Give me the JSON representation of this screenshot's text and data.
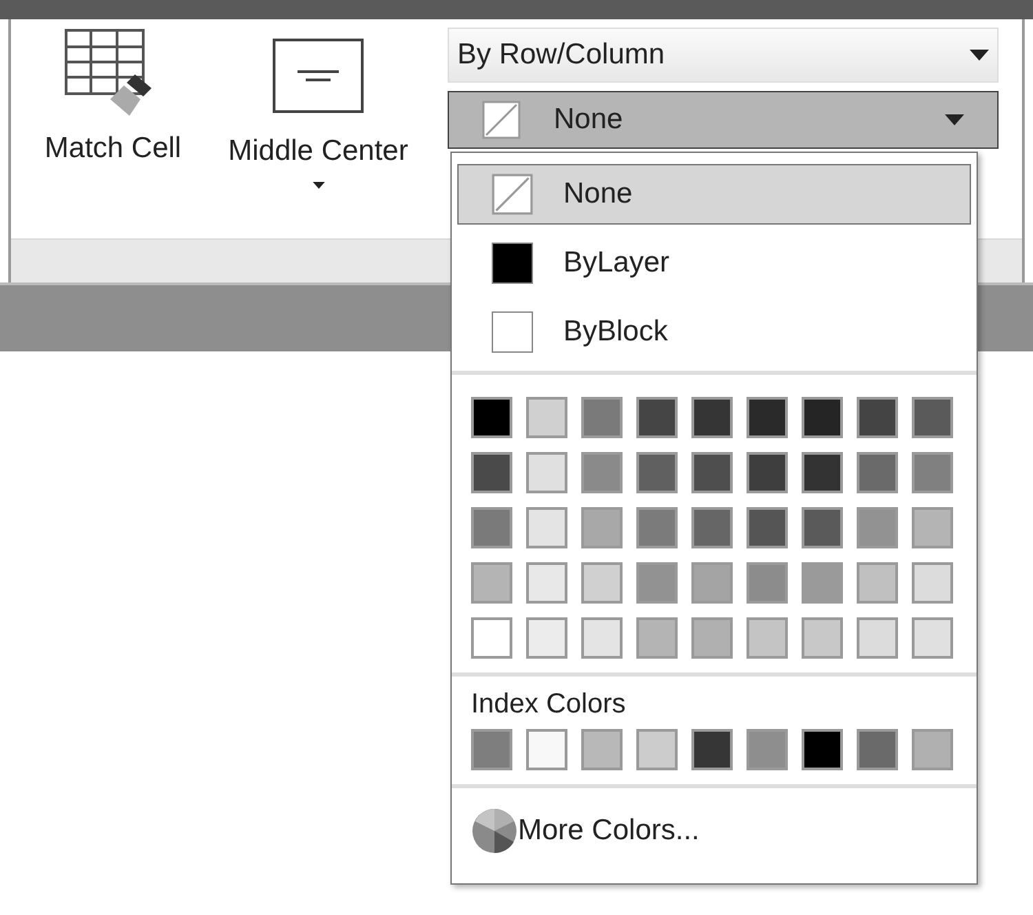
{
  "ribbon": {
    "buttons": [
      {
        "label": "Match Cell",
        "kind": "match",
        "has_menu": false
      },
      {
        "label": "Middle Center",
        "kind": "align",
        "has_menu": true
      }
    ]
  },
  "cell_style_dropdown": {
    "value": "By Row/Column"
  },
  "fill_color_dropdown": {
    "value": "None",
    "expanded": true
  },
  "menu": {
    "items": [
      {
        "label": "None",
        "kind": "none",
        "selected": true
      },
      {
        "label": "ByLayer",
        "kind": "swatch",
        "color": "#000000",
        "selected": false
      },
      {
        "label": "ByBlock",
        "kind": "swatch",
        "color": "#ffffff",
        "selected": false
      }
    ],
    "palette": [
      {
        "swatches": [
          {
            "color": "#000000"
          },
          {
            "color": "#d0d0d0"
          },
          {
            "color": "#7a7a7a"
          },
          {
            "color": "#454545"
          },
          {
            "color": "#353535"
          },
          {
            "color": "#2a2a2a"
          },
          {
            "color": "#252525"
          },
          {
            "color": "#444444"
          },
          {
            "color": "#5a5a5a"
          }
        ]
      },
      {
        "swatches": [
          {
            "color": "#4a4a4a"
          },
          {
            "color": "#e0e0e0"
          },
          {
            "color": "#8a8a8a"
          },
          {
            "color": "#606060"
          },
          {
            "color": "#4e4e4e"
          },
          {
            "color": "#3e3e3e"
          },
          {
            "color": "#333333"
          },
          {
            "color": "#6a6a6a"
          },
          {
            "color": "#808080"
          }
        ]
      },
      {
        "swatches": [
          {
            "color": "#7a7a7a"
          },
          {
            "color": "#e4e4e4"
          },
          {
            "color": "#a8a8a8"
          },
          {
            "color": "#7b7b7b"
          },
          {
            "color": "#666666"
          },
          {
            "color": "#555555"
          },
          {
            "color": "#5a5a5a"
          },
          {
            "color": "#929292"
          },
          {
            "color": "#b4b4b4"
          }
        ]
      },
      {
        "swatches": [
          {
            "color": "#b4b4b4"
          },
          {
            "color": "#e8e8e8"
          },
          {
            "color": "#d0d0d0"
          },
          {
            "color": "#929292"
          },
          {
            "color": "#a4a4a4"
          },
          {
            "color": "#8c8c8c"
          },
          {
            "color": "#9a9a9a"
          },
          {
            "color": "#c0c0c0"
          },
          {
            "color": "#dcdcdc"
          }
        ]
      },
      {
        "swatches": [
          {
            "color": "#ffffff"
          },
          {
            "color": "#ececec"
          },
          {
            "color": "#e4e4e4"
          },
          {
            "color": "#b4b4b4"
          },
          {
            "color": "#b0b0b0"
          },
          {
            "color": "#c4c4c4"
          },
          {
            "color": "#c8c8c8"
          },
          {
            "color": "#dcdcdc"
          },
          {
            "color": "#e0e0e0"
          }
        ]
      }
    ],
    "index_colors": {
      "title": "Index Colors",
      "swatches": [
        {
          "color": "#7e7e7e"
        },
        {
          "color": "#f8f8f8"
        },
        {
          "color": "#b8b8b8"
        },
        {
          "color": "#cccccc"
        },
        {
          "color": "#363636"
        },
        {
          "color": "#8e8e8e"
        },
        {
          "color": "#000000"
        },
        {
          "color": "#6a6a6a"
        },
        {
          "color": "#b0b0b0"
        }
      ]
    },
    "more_colors": "More Colors..."
  }
}
